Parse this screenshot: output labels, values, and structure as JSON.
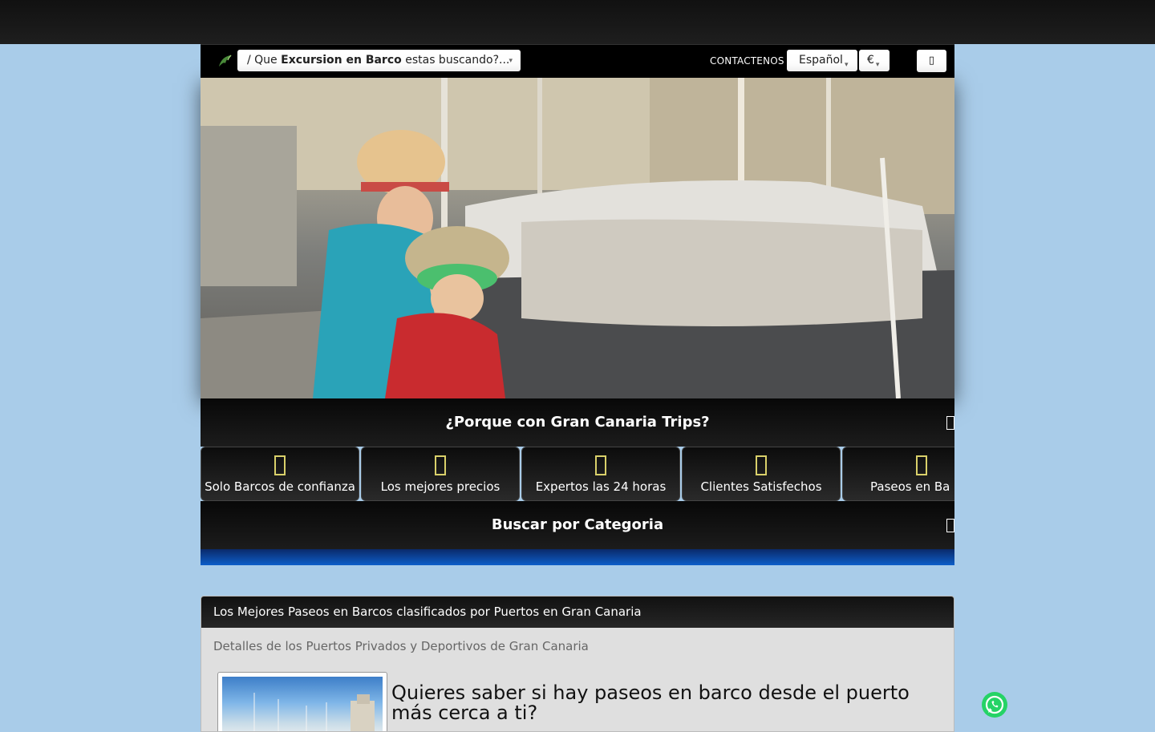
{
  "header": {
    "search_prefix": "/ Que ",
    "search_bold": "Excursion en Barco",
    "search_suffix": " estas buscando?...",
    "contact_label": "CONTACTENOS",
    "language": "Español",
    "currency": "€",
    "menu_icon": "menu-icon",
    "logo_icon": "dolphin-logo-icon"
  },
  "sections": {
    "why_title": "¿Porque con Gran Canaria Trips?",
    "category_title": "Buscar por Categoria"
  },
  "features": [
    {
      "label": "Solo Barcos de confianza",
      "icon": "trust-icon"
    },
    {
      "label": "Los mejores precios",
      "icon": "price-icon"
    },
    {
      "label": "Expertos las 24 horas",
      "icon": "clock-icon"
    },
    {
      "label": "Clientes Satisfechos",
      "icon": "smile-icon"
    },
    {
      "label": "Paseos en Ba",
      "icon": "boat-icon"
    }
  ],
  "panel": {
    "title": "Los Mejores Paseos en Barcos clasificados por Puertos en Gran Canaria",
    "subtitle": "Detalles de los Puertos Privados y Deportivos de Gran Canaria",
    "question": "Quieres saber si hay paseos en barco desde el puerto más cerca a ti?"
  },
  "colors": {
    "page_background": "#a9cce9",
    "feature_icon": "#d9d06a",
    "whatsapp": "#25d366",
    "blue_strip": "#0d5ec9"
  },
  "whatsapp_icon": "whatsapp-icon"
}
